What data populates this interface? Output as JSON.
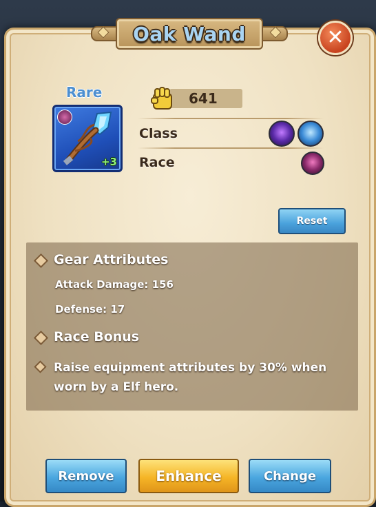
{
  "title": "Oak Wand",
  "close_icon": "close-x-icon",
  "item": {
    "rarity": "Rare",
    "level": "+3",
    "icon": "oak-wand-icon",
    "badge_icon": "elf-race-icon"
  },
  "power": {
    "icon": "fist-icon",
    "value": "641"
  },
  "requirements": {
    "class_label": "Class",
    "class_icons": [
      "dark-mage-class-icon",
      "ice-mage-class-icon"
    ],
    "race_label": "Race",
    "race_icon": "elf-race-icon"
  },
  "reset_label": "Reset",
  "attributes": {
    "heading": "Gear Attributes",
    "lines": [
      "Attack Damage: 156",
      "Defense: 17"
    ]
  },
  "race_bonus": {
    "heading": "Race Bonus",
    "text": "Raise equipment attributes by 30% when worn by a Elf hero."
  },
  "actions": {
    "remove": "Remove",
    "enhance": "Enhance",
    "change": "Change"
  },
  "colors": {
    "title_text": "#a9d4f2",
    "rarity_text": "#4d8fd0",
    "item_frame": "#1f4fb8",
    "level_text": "#8ff07a",
    "button_blue": "#4aa6df",
    "button_gold": "#f5b526"
  }
}
